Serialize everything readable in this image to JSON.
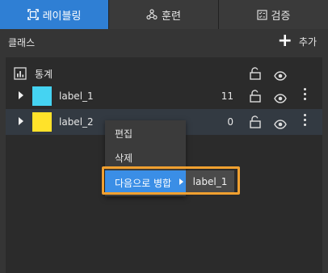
{
  "tabs": [
    {
      "label": "레이블링",
      "icon": "labeling-icon",
      "active": true
    },
    {
      "label": "훈련",
      "icon": "training-icon",
      "active": false
    },
    {
      "label": "검증",
      "icon": "validation-icon",
      "active": false
    }
  ],
  "class_header": {
    "title": "클래스",
    "add_label": "추가"
  },
  "stats": {
    "label": "통계"
  },
  "classes": [
    {
      "name": "label_1",
      "count": "11",
      "color": "#45d3f2"
    },
    {
      "name": "label_2",
      "count": "0",
      "color": "#ffe22a"
    }
  ],
  "context_menu": {
    "edit": "편집",
    "delete": "삭제",
    "merge": "다음으로 병합",
    "merge_target": "label_1"
  },
  "colors": {
    "accent": "#2f7fd4",
    "highlight": "#f0a030",
    "menu_selected": "#3a8ee6"
  }
}
